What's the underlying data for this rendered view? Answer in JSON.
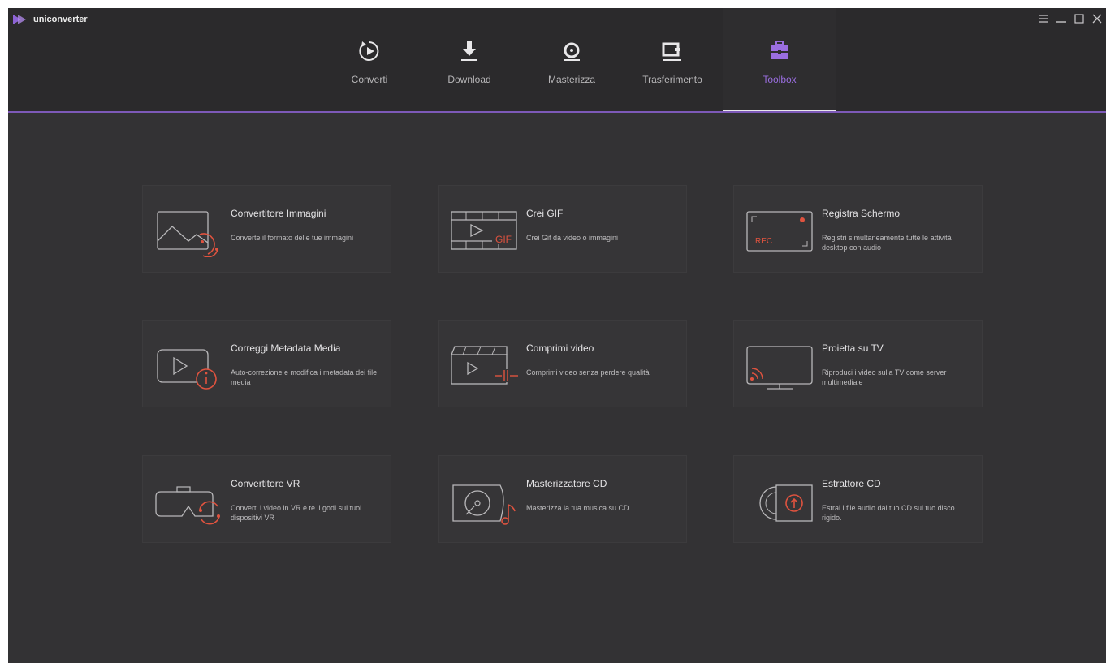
{
  "app": {
    "name": "uniconverter",
    "accent_color": "#7d59b8",
    "highlight_color": "#e0533f"
  },
  "window_controls": {
    "menu_icon": "menu-icon",
    "minimize_icon": "minimize-icon",
    "maximize_icon": "maximize-icon",
    "close_icon": "close-icon"
  },
  "tabs": [
    {
      "label": "Converti",
      "icon": "convert-play-icon",
      "active": false
    },
    {
      "label": "Download",
      "icon": "download-icon",
      "active": false
    },
    {
      "label": "Masterizza",
      "icon": "burn-disc-icon",
      "active": false
    },
    {
      "label": "Trasferimento",
      "icon": "transfer-icon",
      "active": false
    },
    {
      "label": "Toolbox",
      "icon": "toolbox-icon",
      "active": true
    }
  ],
  "tools": [
    {
      "title": "Convertitore Immagini",
      "description": "Converte il formato delle tue immagini",
      "icon": "image-converter-icon"
    },
    {
      "title": "Crei GIF",
      "description": "Crei Gif da video o immagini",
      "icon": "gif-maker-icon",
      "icon_text": "GIF"
    },
    {
      "title": "Registra Schermo",
      "description": "Registri simultaneamente tutte le attività desktop con audio",
      "icon": "screen-recorder-icon",
      "icon_text": "REC"
    },
    {
      "title": "Correggi Metadata Media",
      "description": "Auto-correzione e modifica i metadata dei file media",
      "icon": "metadata-fix-icon"
    },
    {
      "title": "Comprimi video",
      "description": "Comprimi video senza perdere qualità",
      "icon": "video-compress-icon"
    },
    {
      "title": "Proietta su TV",
      "description": "Riproduci i video sulla TV come server multimediale",
      "icon": "cast-to-tv-icon"
    },
    {
      "title": "Convertitore VR",
      "description": "Converti i video in VR e te li godi sui tuoi dispositivi VR",
      "icon": "vr-converter-icon"
    },
    {
      "title": "Masterizzatore CD",
      "description": "Masterizza la tua musica su CD",
      "icon": "cd-burner-icon"
    },
    {
      "title": "Estrattore CD",
      "description": "Estrai i file audio dal tuo CD sul tuo disco rigido.",
      "icon": "cd-ripper-icon"
    }
  ]
}
